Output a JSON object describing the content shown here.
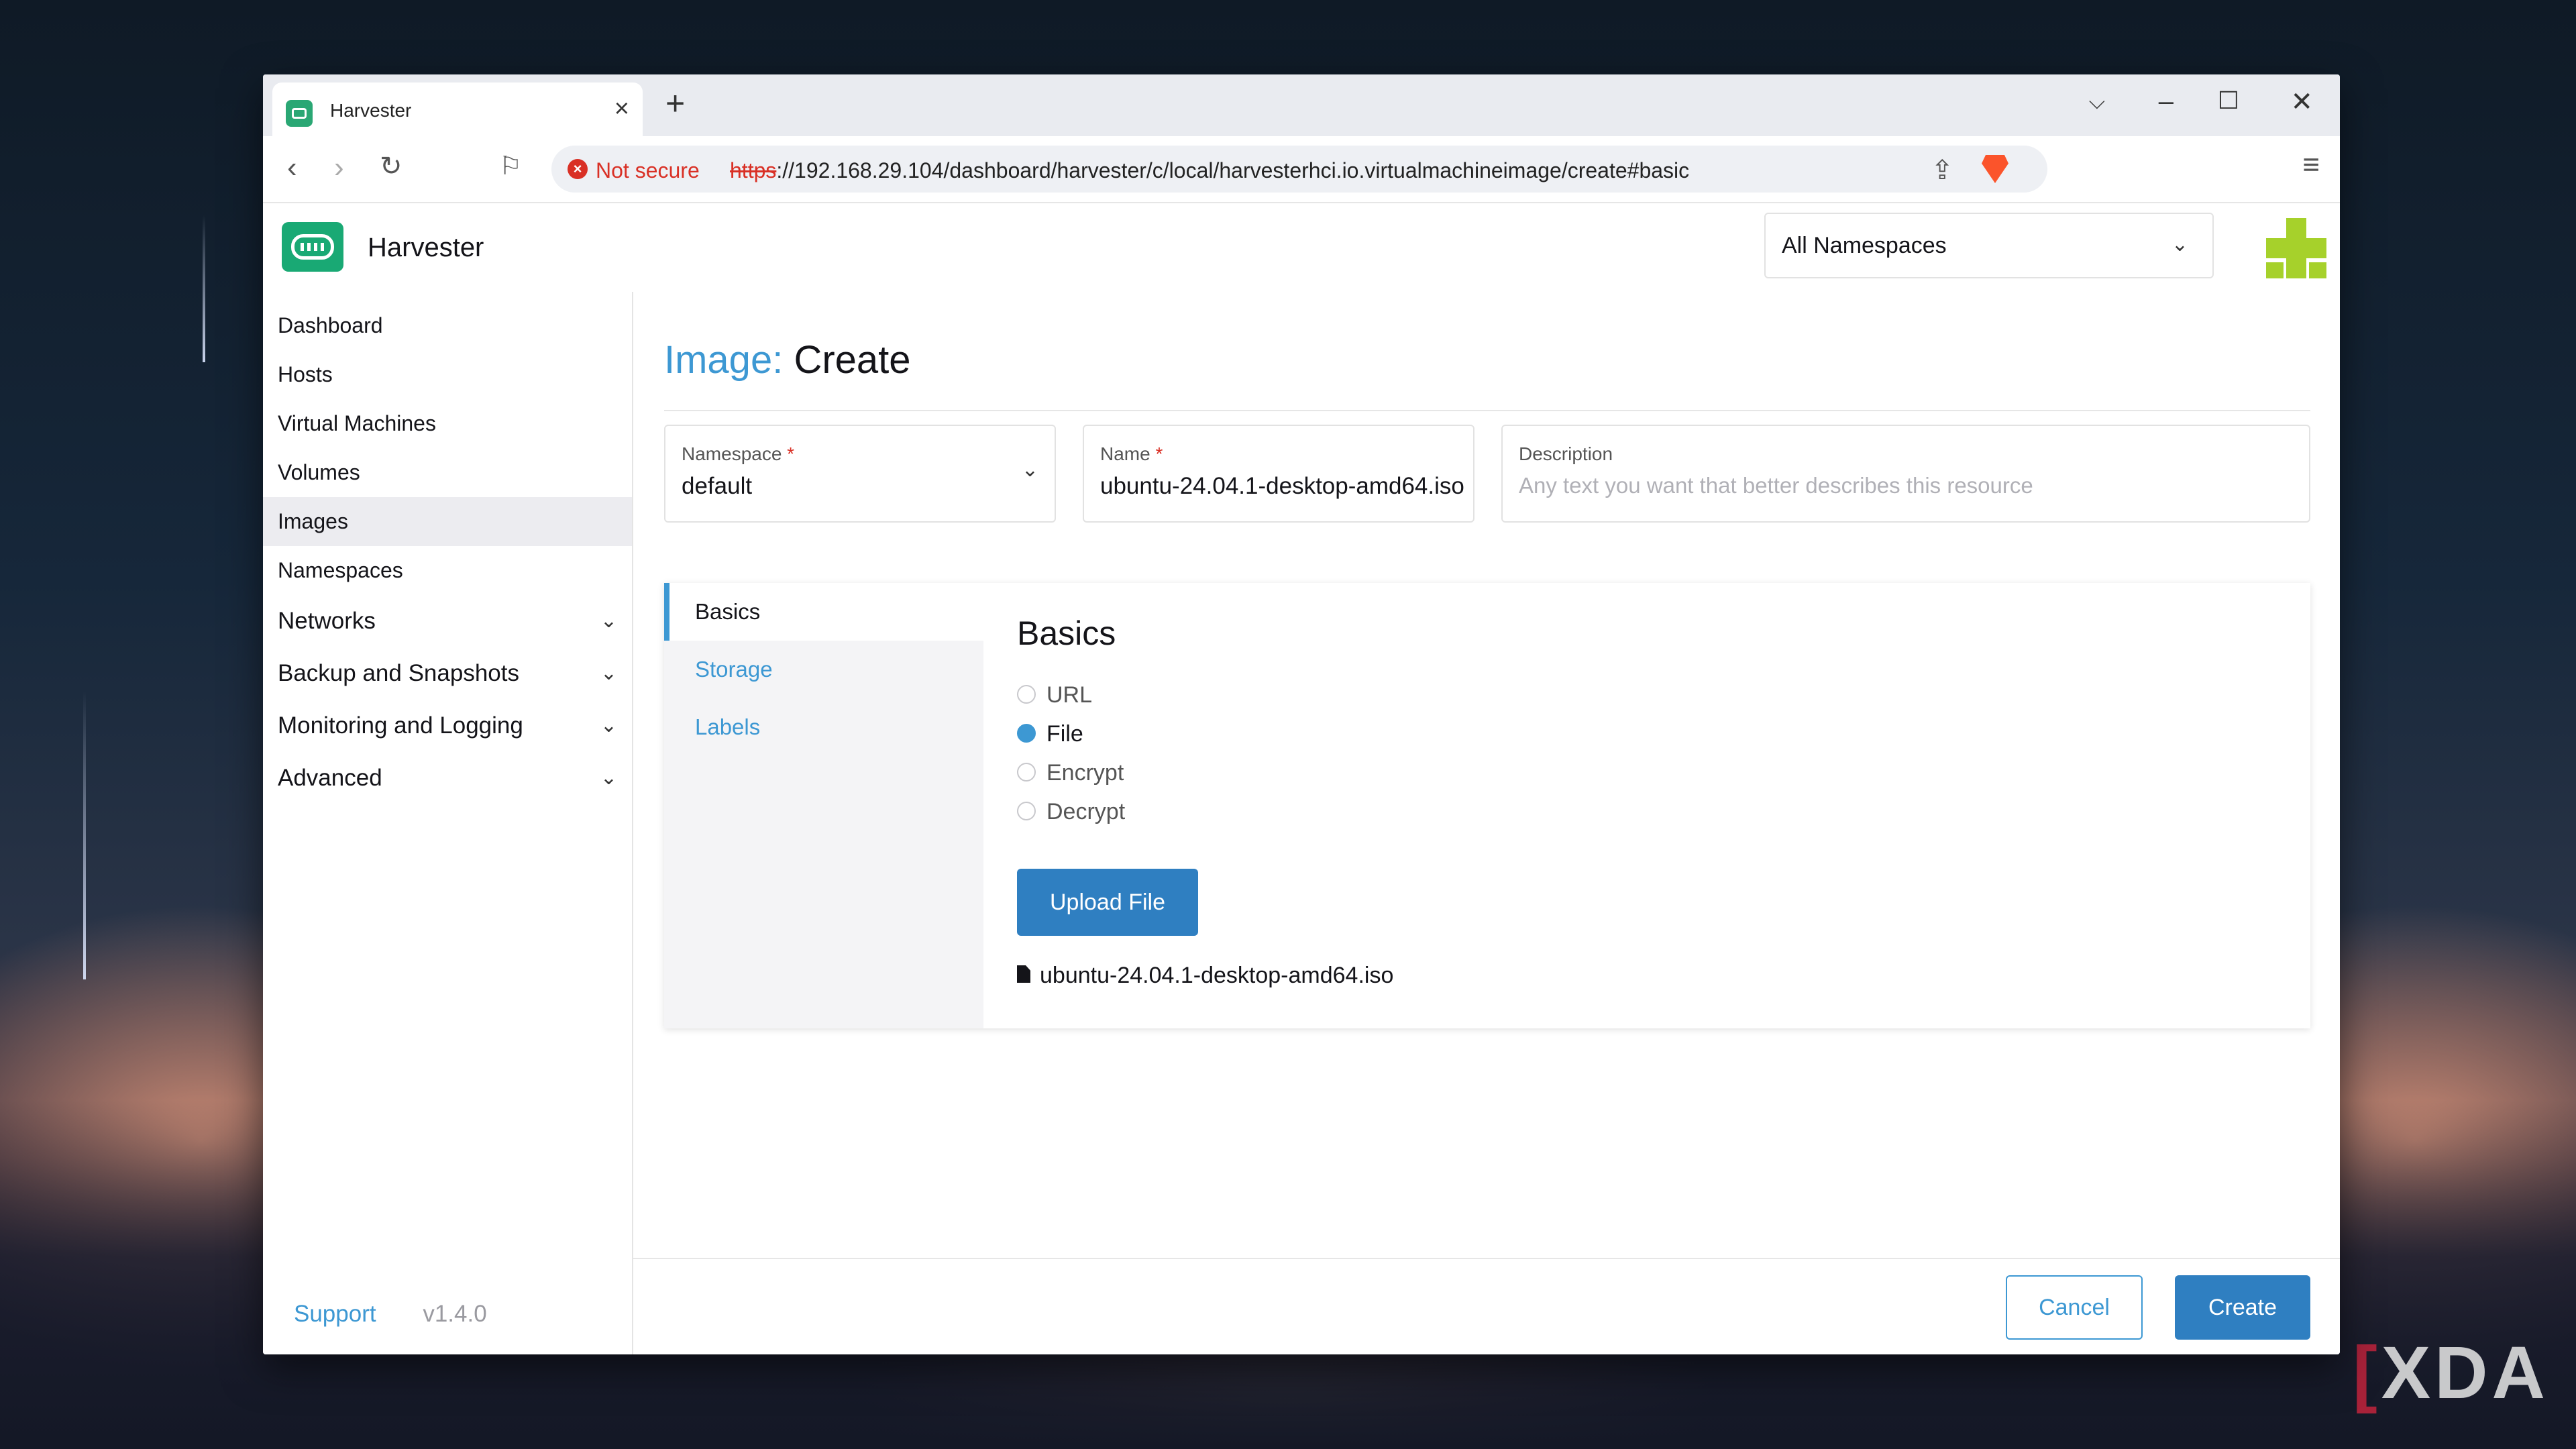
{
  "browser": {
    "tab_title": "Harvester",
    "security_label": "Not secure",
    "url_scheme": "https",
    "url_rest": "://192.168.29.104/dashboard/harvester/c/local/harvesterhci.io.virtualmachineimage/create#basic"
  },
  "app": {
    "name": "Harvester",
    "namespace_filter": "All Namespaces"
  },
  "sidebar": {
    "items": [
      {
        "label": "Dashboard"
      },
      {
        "label": "Hosts"
      },
      {
        "label": "Virtual Machines"
      },
      {
        "label": "Volumes"
      },
      {
        "label": "Images"
      },
      {
        "label": "Namespaces"
      }
    ],
    "groups": [
      {
        "label": "Networks"
      },
      {
        "label": "Backup and Snapshots"
      },
      {
        "label": "Monitoring and Logging"
      },
      {
        "label": "Advanced"
      }
    ],
    "support": "Support",
    "version": "v1.4.0"
  },
  "page": {
    "title_kind": "Image:",
    "title_action": "Create",
    "namespace": {
      "label": "Namespace",
      "value": "default"
    },
    "name": {
      "label": "Name",
      "value": "ubuntu-24.04.1-desktop-amd64.iso"
    },
    "description": {
      "label": "Description",
      "placeholder": "Any text you want that better describes this resource"
    },
    "tabs": [
      {
        "label": "Basics"
      },
      {
        "label": "Storage"
      },
      {
        "label": "Labels"
      }
    ],
    "basics": {
      "title": "Basics",
      "options": [
        {
          "label": "URL"
        },
        {
          "label": "File"
        },
        {
          "label": "Encrypt"
        },
        {
          "label": "Decrypt"
        }
      ],
      "selected": "File",
      "upload_label": "Upload File",
      "file_name": "ubuntu-24.04.1-desktop-amd64.iso"
    },
    "cancel_label": "Cancel",
    "create_label": "Create"
  },
  "watermark": "XDA",
  "colors": {
    "accent": "#3d98d3",
    "primary_button": "#2f7fc1",
    "logo": "#19a974",
    "danger": "#d93025"
  }
}
